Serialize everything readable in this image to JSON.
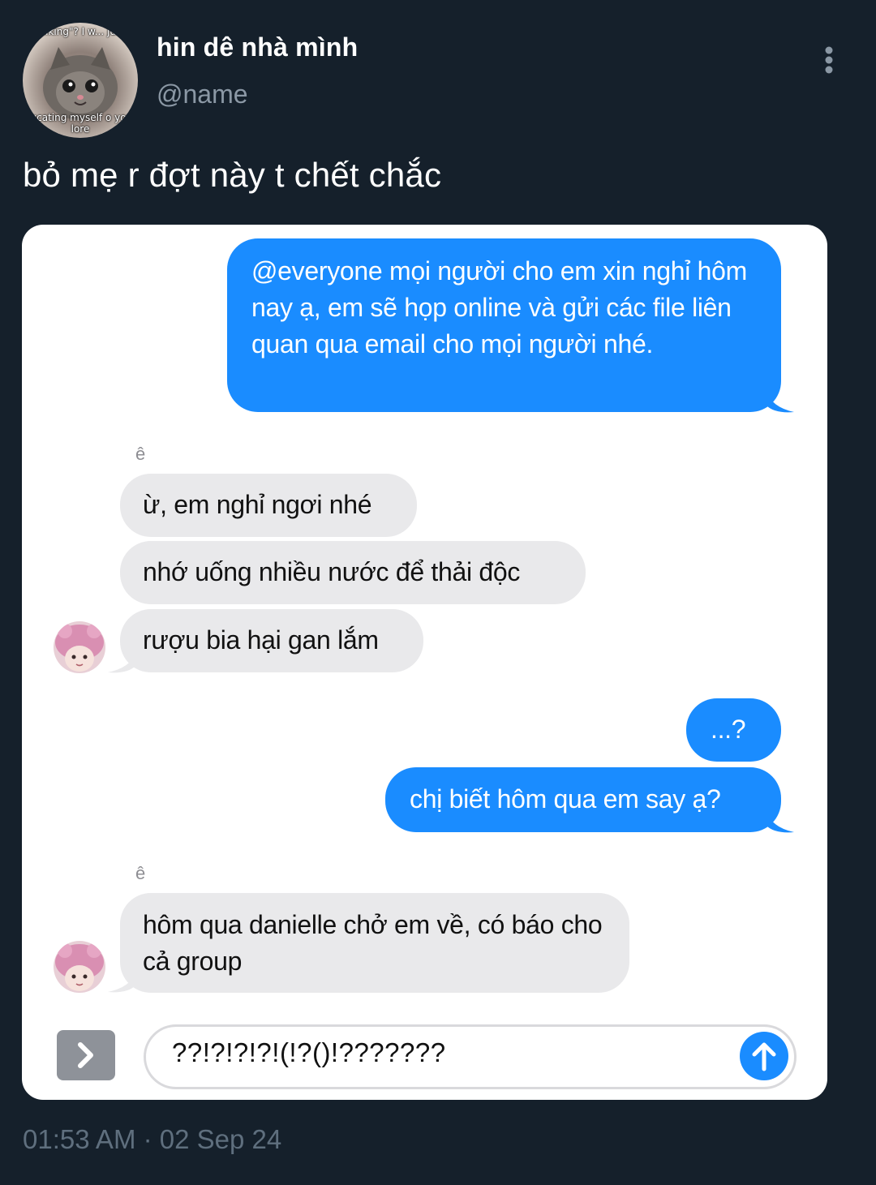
{
  "tweet": {
    "display_name": "hin dê nhà mình",
    "handle": "@name",
    "text": "bỏ mẹ r đợt này t chết chắc",
    "timestamp": "01:53 AM · 02 Sep 24",
    "avatar_caption_top": "talking\"? I w... just",
    "avatar_caption_bottom": "ducating myself o your lore",
    "more_icon": "vertical-ellipsis-icon"
  },
  "chat": {
    "messages": [
      {
        "from": "me",
        "text": "@everyone mọi người cho em xin nghỉ hôm nay ạ, em sẽ họp online và gửi các file liên quan qua email cho mọi người nhé."
      },
      {
        "from": "sender",
        "sender_label": "ê"
      },
      {
        "from": "them",
        "text": "ừ, em nghỉ ngơi nhé"
      },
      {
        "from": "them",
        "text": "nhớ uống nhiều nước để thải độc"
      },
      {
        "from": "them",
        "text": "rượu bia hại gan lắm"
      },
      {
        "from": "me",
        "text": "...?"
      },
      {
        "from": "me",
        "text": "chị biết hôm qua em say ạ?"
      },
      {
        "from": "sender",
        "sender_label": "ê"
      },
      {
        "from": "them",
        "text": "hôm qua danielle chở em về, có báo cho cả group"
      }
    ],
    "compose": {
      "value": "??!?!?!?!(!?()!???????",
      "expand_icon": "chevron-right-icon",
      "send_icon": "arrow-up-icon"
    }
  },
  "colors": {
    "background": "#15202b",
    "outgoing_bubble": "#1a8cff",
    "incoming_bubble": "#e9e9eb",
    "muted_text": "#8b98a5"
  }
}
